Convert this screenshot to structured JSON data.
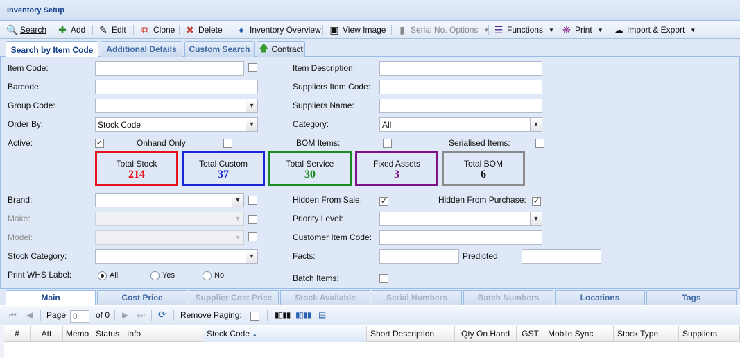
{
  "window": {
    "title": "Inventory Setup"
  },
  "toolbar": {
    "search": "Search",
    "add": "Add",
    "edit": "Edit",
    "clone": "Clone",
    "delete": "Delete",
    "inventory_overview": "Inventory Overview",
    "view_image": "View Image",
    "serial_options": "Serial No. Options",
    "functions": "Functions",
    "print": "Print",
    "import_export": "Import & Export"
  },
  "tabs": [
    "Search by Item Code",
    "Additional Details",
    "Custom Search",
    "Contract"
  ],
  "form": {
    "item_code": {
      "label": "Item Code:",
      "value": ""
    },
    "barcode": {
      "label": "Barcode:",
      "value": ""
    },
    "group_code": {
      "label": "Group Code:",
      "value": ""
    },
    "order_by": {
      "label": "Order By:",
      "value": "Stock Code"
    },
    "active": {
      "label": "Active:",
      "checked": true
    },
    "onhand_only": {
      "label": "Onhand Only:",
      "checked": false
    },
    "item_description": {
      "label": "Item Description:",
      "value": ""
    },
    "suppliers_item_code": {
      "label": "Suppliers Item Code:",
      "value": ""
    },
    "suppliers_name": {
      "label": "Suppliers Name:",
      "value": ""
    },
    "category": {
      "label": "Category:",
      "value": "All"
    },
    "bom_items": {
      "label": "BOM Items:",
      "checked": false
    },
    "serialised_items": {
      "label": "Serialised Items:",
      "checked": false
    },
    "brand": {
      "label": "Brand:",
      "value": ""
    },
    "make": {
      "label": "Make:",
      "value": ""
    },
    "model": {
      "label": "Model:",
      "value": ""
    },
    "stock_category": {
      "label": "Stock Category:",
      "value": ""
    },
    "print_whs_label": {
      "label": "Print WHS Label:",
      "options": [
        "All",
        "Yes",
        "No"
      ],
      "selected": "All"
    },
    "hidden_from_sale": {
      "label": "Hidden From Sale:",
      "checked": true
    },
    "hidden_from_purchase": {
      "label": "Hidden From Purchase:",
      "checked": true
    },
    "priority_level": {
      "label": "Priority Level:",
      "value": ""
    },
    "customer_item_code": {
      "label": "Customer Item Code:",
      "value": ""
    },
    "facts": {
      "label": "Facts:",
      "value": ""
    },
    "predicted": {
      "label": "Predicted:",
      "value": ""
    },
    "batch_items": {
      "label": "Batch Items:",
      "checked": false
    }
  },
  "stats": [
    {
      "label": "Total Stock",
      "value": "214",
      "color": "#e8101a"
    },
    {
      "label": "Total Custom",
      "value": "37",
      "color": "#1a25d6"
    },
    {
      "label": "Total Service",
      "value": "30",
      "color": "#1b8a22"
    },
    {
      "label": "Fixed Assets",
      "value": "3",
      "color": "#7a1387"
    },
    {
      "label": "Total BOM",
      "value": "6",
      "color": "#8a8a8a"
    }
  ],
  "grid_tabs": [
    "Main",
    "Cost Price",
    "Supplier Cost Price",
    "Stock Available",
    "Serial Numbers",
    "Batch Numbers",
    "Locations",
    "Tags"
  ],
  "pager": {
    "page_label": "Page",
    "page_value": "0",
    "of_label": "of 0",
    "remove_paging": "Remove Paging:"
  },
  "columns": [
    "#",
    "Att",
    "Memo",
    "Status",
    "Info",
    "Stock Code",
    "Short Description",
    "Qty On Hand",
    "GST",
    "Mobile Sync",
    "Stock Type",
    "Suppliers"
  ],
  "colors": {
    "accent": "#15428b",
    "panel": "#dfe8f6",
    "border": "#99bbe8"
  }
}
